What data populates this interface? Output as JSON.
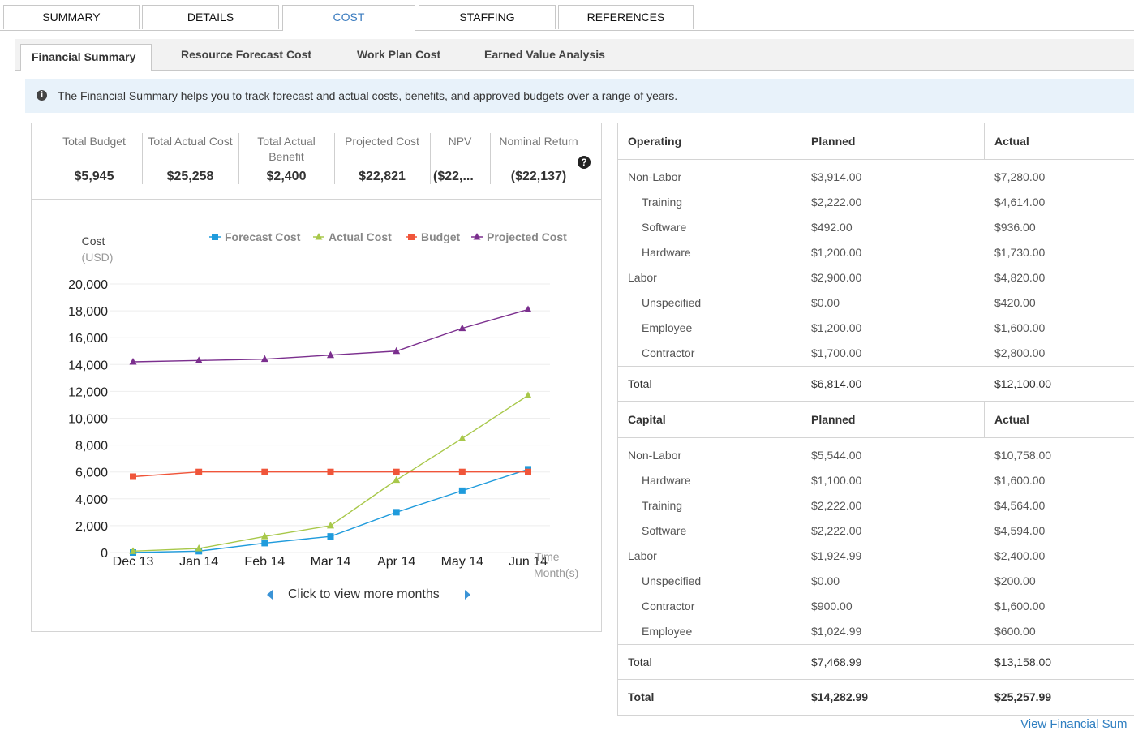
{
  "top_tabs": [
    {
      "label": "SUMMARY",
      "active": false
    },
    {
      "label": "DETAILS",
      "active": false
    },
    {
      "label": "COST",
      "active": true
    },
    {
      "label": "STAFFING",
      "active": false
    },
    {
      "label": "REFERENCES",
      "active": false
    }
  ],
  "sub_tabs": [
    {
      "label": "Financial Summary",
      "active": true
    },
    {
      "label": "Resource Forecast Cost",
      "active": false
    },
    {
      "label": "Work Plan Cost",
      "active": false
    },
    {
      "label": "Earned Value Analysis",
      "active": false
    }
  ],
  "info": {
    "icon": "info-icon",
    "text": "The Financial Summary helps you to track forecast and actual costs, benefits, and approved budgets over a range of years."
  },
  "metrics": [
    {
      "label": "Total Budget",
      "value": "$5,945"
    },
    {
      "label": "Total Actual Cost",
      "value": "$25,258"
    },
    {
      "label": "Total Actual Benefit",
      "value": "$2,400"
    },
    {
      "label": "Projected Cost",
      "value": "$22,821"
    },
    {
      "label": "NPV",
      "value": "($22,..."
    },
    {
      "label": "Nominal Return",
      "value": "($22,137)"
    }
  ],
  "help_icon": "question-icon",
  "chart_data": {
    "type": "line",
    "ylabel": "Cost",
    "ylabel_unit": "(USD)",
    "xlabel": "Time",
    "xlabel_unit": "Month(s)",
    "categories": [
      "Dec 13",
      "Jan 14",
      "Feb 14",
      "Mar 14",
      "Apr 14",
      "May 14",
      "Jun 14"
    ],
    "ylim": [
      0,
      20000
    ],
    "yticks": [
      0,
      2000,
      4000,
      6000,
      8000,
      10000,
      12000,
      14000,
      16000,
      18000,
      20000
    ],
    "ytick_labels": [
      "0",
      "2,000",
      "4,000",
      "6,000",
      "8,000",
      "10,000",
      "12,000",
      "14,000",
      "16,000",
      "18,000",
      "20,000"
    ],
    "legend_position": "top",
    "series": [
      {
        "name": "Forecast Cost",
        "color": "#1f9bdc",
        "marker": "square",
        "values": [
          0,
          100,
          700,
          1200,
          3000,
          4600,
          6200
        ]
      },
      {
        "name": "Actual Cost",
        "color": "#a8c84a",
        "marker": "triangle",
        "values": [
          100,
          300,
          1200,
          2000,
          5400,
          8500,
          11700
        ]
      },
      {
        "name": "Budget",
        "color": "#f0553a",
        "marker": "square",
        "values": [
          5650,
          6000,
          6000,
          6000,
          6000,
          6000,
          6000
        ]
      },
      {
        "name": "Projected Cost",
        "color": "#7b2f8e",
        "marker": "triangle",
        "values": [
          14200,
          14300,
          14400,
          14700,
          15000,
          16700,
          18100
        ]
      }
    ]
  },
  "chart_nav": {
    "text": "Click to view more months"
  },
  "cost_table": {
    "operating": {
      "header": [
        "Operating",
        "Planned",
        "Actual"
      ],
      "rows": [
        {
          "label": "Non-Labor",
          "planned": "$3,914.00",
          "actual": "$7,280.00",
          "indent": false
        },
        {
          "label": "Training",
          "planned": "$2,222.00",
          "actual": "$4,614.00",
          "indent": true
        },
        {
          "label": "Software",
          "planned": "$492.00",
          "actual": "$936.00",
          "indent": true
        },
        {
          "label": "Hardware",
          "planned": "$1,200.00",
          "actual": "$1,730.00",
          "indent": true
        },
        {
          "label": "Labor",
          "planned": "$2,900.00",
          "actual": "$4,820.00",
          "indent": false
        },
        {
          "label": "Unspecified",
          "planned": "$0.00",
          "actual": "$420.00",
          "indent": true
        },
        {
          "label": "Employee",
          "planned": "$1,200.00",
          "actual": "$1,600.00",
          "indent": true
        },
        {
          "label": "Contractor",
          "planned": "$1,700.00",
          "actual": "$2,800.00",
          "indent": true
        }
      ],
      "total": {
        "label": "Total",
        "planned": "$6,814.00",
        "actual": "$12,100.00"
      }
    },
    "capital": {
      "header": [
        "Capital",
        "Planned",
        "Actual"
      ],
      "rows": [
        {
          "label": "Non-Labor",
          "planned": "$5,544.00",
          "actual": "$10,758.00",
          "indent": false
        },
        {
          "label": "Hardware",
          "planned": "$1,100.00",
          "actual": "$1,600.00",
          "indent": true
        },
        {
          "label": "Training",
          "planned": "$2,222.00",
          "actual": "$4,564.00",
          "indent": true
        },
        {
          "label": "Software",
          "planned": "$2,222.00",
          "actual": "$4,594.00",
          "indent": true
        },
        {
          "label": "Labor",
          "planned": "$1,924.99",
          "actual": "$2,400.00",
          "indent": false
        },
        {
          "label": "Unspecified",
          "planned": "$0.00",
          "actual": "$200.00",
          "indent": true
        },
        {
          "label": "Contractor",
          "planned": "$900.00",
          "actual": "$1,600.00",
          "indent": true
        },
        {
          "label": "Employee",
          "planned": "$1,024.99",
          "actual": "$600.00",
          "indent": true
        }
      ],
      "total": {
        "label": "Total",
        "planned": "$7,468.99",
        "actual": "$13,158.00"
      }
    },
    "grand_total": {
      "label": "Total",
      "planned": "$14,282.99",
      "actual": "$25,257.99"
    }
  },
  "view_link": "View Financial Sum"
}
